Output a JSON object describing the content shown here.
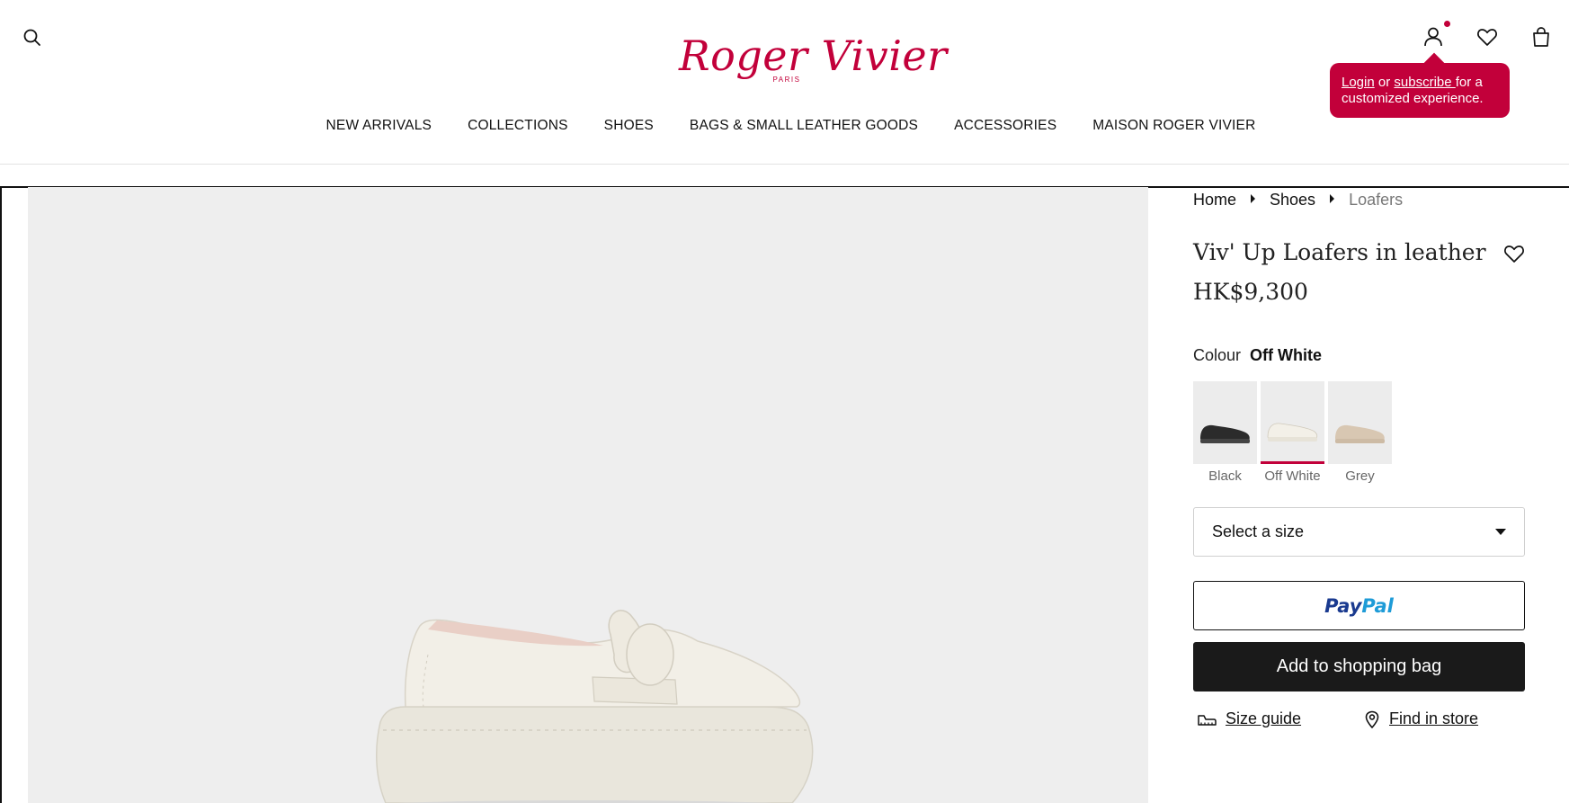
{
  "brand": {
    "logo_text": "Roger Vivier",
    "logo_sub": "PARIS",
    "brand_color": "#c2003a"
  },
  "header": {
    "icons": [
      "search-icon",
      "user-icon",
      "heart-icon",
      "shopping-bag-icon"
    ],
    "tooltip": {
      "login": "Login",
      "or": " or ",
      "subscribe": "subscribe ",
      "rest": "for a customized experience."
    }
  },
  "nav": {
    "items": [
      "NEW ARRIVALS",
      "COLLECTIONS",
      "SHOES",
      "BAGS & SMALL LEATHER GOODS",
      "ACCESSORIES",
      "MAISON ROGER VIVIER"
    ]
  },
  "breadcrumb": {
    "items": [
      "Home",
      "Shoes"
    ],
    "current": "Loafers"
  },
  "product": {
    "title": "Viv' Up Loafers in leather",
    "price": "HK$9,300",
    "colour_label": "Colour",
    "colour_value": "Off White",
    "swatches": [
      {
        "label": "Black",
        "color": "#2b2b2b"
      },
      {
        "label": "Off White",
        "color": "#efece4"
      },
      {
        "label": "Grey",
        "color": "#d8c7b2"
      }
    ],
    "selected_swatch": "Off White",
    "size_placeholder": "Select a size",
    "paypal_a": "Pay",
    "paypal_b": "Pal",
    "add_to_bag": "Add to shopping bag",
    "size_guide": "Size guide",
    "find_in_store": "Find in store"
  }
}
